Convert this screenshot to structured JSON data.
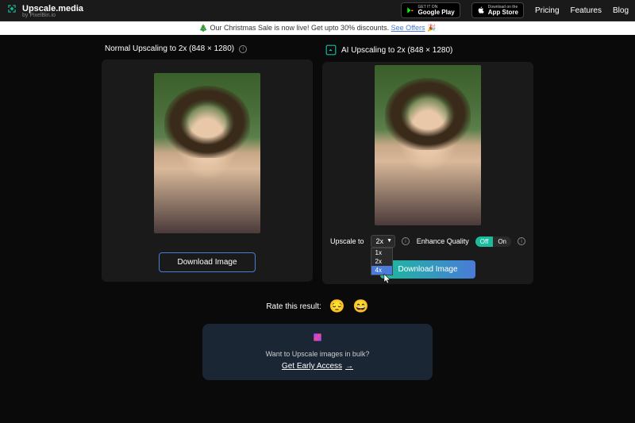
{
  "header": {
    "logo_text": "Upscale.media",
    "logo_sub": "by PixelBin.io",
    "google_play_top": "GET IT ON",
    "google_play": "Google Play",
    "app_store_top": "Download on the",
    "app_store": "App Store",
    "nav": {
      "pricing": "Pricing",
      "features": "Features",
      "blog": "Blog"
    }
  },
  "promo": {
    "text": "Our Christmas Sale is now live! Get upto 30% discounts.",
    "link": "See Offers",
    "emoji": "🎄",
    "party": "🎉"
  },
  "panels": {
    "normal": {
      "title": "Normal Upscaling to 2x (848 × 1280)",
      "download": "Download Image"
    },
    "ai": {
      "title": "AI Upscaling to 2x (848 × 1280)",
      "download": "Download Image",
      "upscale_label": "Upscale to",
      "upscale_value": "2x",
      "options": [
        "1x",
        "2x",
        "4x"
      ],
      "enhance_label": "Enhance Quality",
      "toggle_off": "Off",
      "toggle_on": "On"
    }
  },
  "rate": {
    "label": "Rate this result:"
  },
  "bulk": {
    "text": "Want to Upscale images in bulk?",
    "link": "Get Early Access"
  }
}
